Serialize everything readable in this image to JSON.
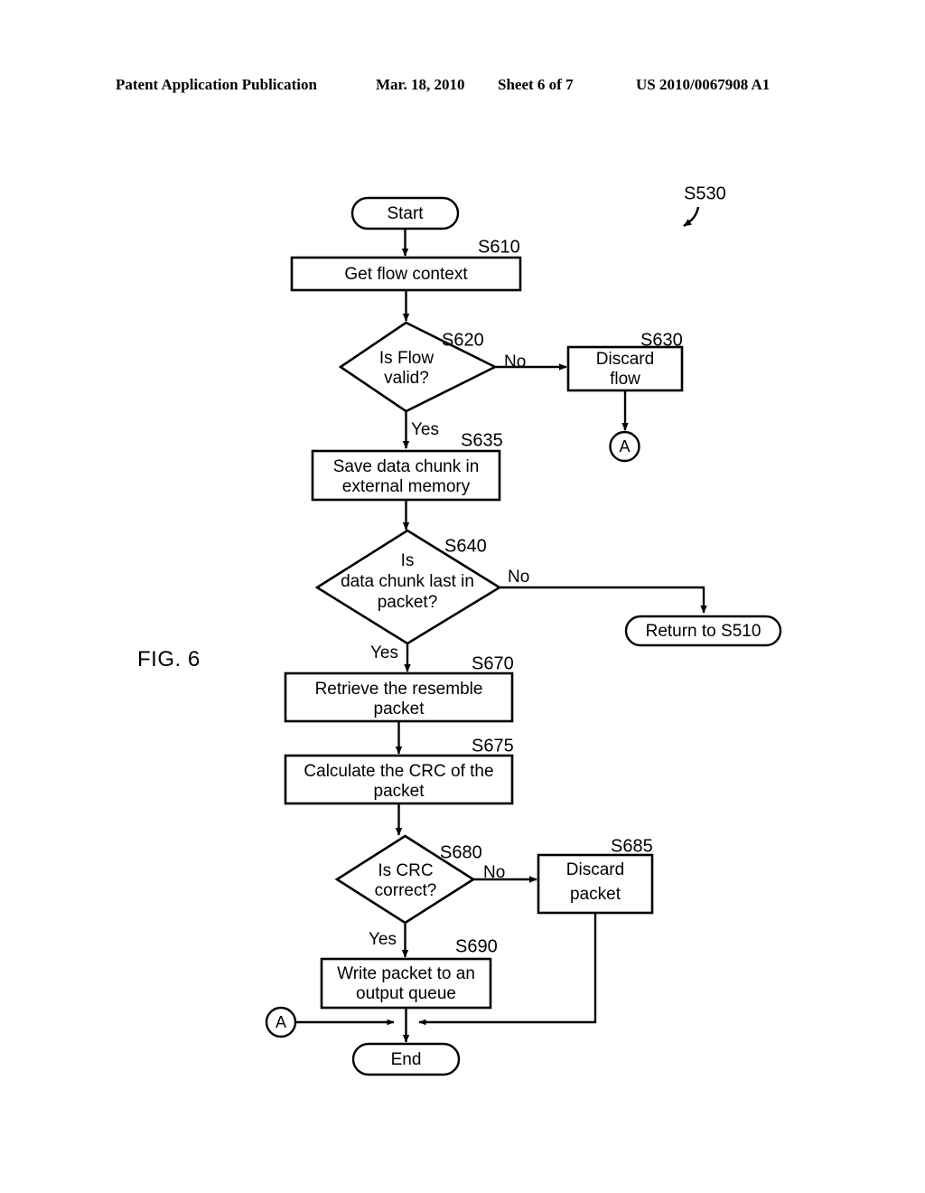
{
  "header": {
    "publication": "Patent Application Publication",
    "date": "Mar. 18, 2010",
    "sheet": "Sheet 6 of 7",
    "patent_number": "US 2010/0067908 A1"
  },
  "figure": {
    "label": "FIG. 6",
    "overall_ref": "S530"
  },
  "flowchart": {
    "type": "flowchart",
    "nodes": [
      {
        "id": "start",
        "shape": "terminator",
        "ref": "",
        "label": "Start"
      },
      {
        "id": "s610",
        "shape": "process",
        "ref": "S610",
        "label": "Get flow context"
      },
      {
        "id": "s620",
        "shape": "decision",
        "ref": "S620",
        "label_line1": "Is Flow",
        "label_line2": "valid?"
      },
      {
        "id": "s630",
        "shape": "process",
        "ref": "S630",
        "label_line1": "Discard",
        "label_line2": "flow"
      },
      {
        "id": "conn_a_top",
        "shape": "connector",
        "ref": "",
        "label": "A"
      },
      {
        "id": "s635",
        "shape": "process",
        "ref": "S635",
        "label_line1": "Save data chunk in",
        "label_line2": "external memory"
      },
      {
        "id": "s640",
        "shape": "decision",
        "ref": "S640",
        "label_line1": "Is",
        "label_line2": "data chunk last in",
        "label_line3": "packet?"
      },
      {
        "id": "return510",
        "shape": "terminator",
        "ref": "",
        "label": "Return to S510"
      },
      {
        "id": "s670",
        "shape": "process",
        "ref": "S670",
        "label_line1": "Retrieve the resemble",
        "label_line2": "packet"
      },
      {
        "id": "s675",
        "shape": "process",
        "ref": "S675",
        "label_line1": "Calculate the CRC of the",
        "label_line2": "packet"
      },
      {
        "id": "s680",
        "shape": "decision",
        "ref": "S680",
        "label_line1": "Is CRC",
        "label_line2": "correct?"
      },
      {
        "id": "s685",
        "shape": "process",
        "ref": "S685",
        "label_line1": "Discard",
        "label_line2": "packet"
      },
      {
        "id": "s690",
        "shape": "process",
        "ref": "S690",
        "label_line1": "Write packet to an",
        "label_line2": "output queue"
      },
      {
        "id": "conn_a_bottom",
        "shape": "connector",
        "ref": "",
        "label": "A"
      },
      {
        "id": "end",
        "shape": "terminator",
        "ref": "",
        "label": "End"
      }
    ],
    "edges": [
      {
        "from": "start",
        "to": "s610",
        "label": ""
      },
      {
        "from": "s610",
        "to": "s620",
        "label": ""
      },
      {
        "from": "s620",
        "to": "s630",
        "label": "No"
      },
      {
        "from": "s620",
        "to": "s635",
        "label": "Yes"
      },
      {
        "from": "s630",
        "to": "conn_a_top",
        "label": ""
      },
      {
        "from": "s635",
        "to": "s640",
        "label": ""
      },
      {
        "from": "s640",
        "to": "return510",
        "label": "No"
      },
      {
        "from": "s640",
        "to": "s670",
        "label": "Yes"
      },
      {
        "from": "s670",
        "to": "s675",
        "label": ""
      },
      {
        "from": "s675",
        "to": "s680",
        "label": ""
      },
      {
        "from": "s680",
        "to": "s685",
        "label": "No"
      },
      {
        "from": "s680",
        "to": "s690",
        "label": "Yes"
      },
      {
        "from": "s690",
        "to": "end",
        "label": ""
      },
      {
        "from": "s685",
        "to": "end",
        "label": ""
      },
      {
        "from": "conn_a_bottom",
        "to": "end",
        "label": ""
      }
    ],
    "labels": {
      "start": "Start",
      "s610": "Get flow context",
      "s620_l1": "Is Flow",
      "s620_l2": "valid?",
      "s630_l1": "Discard",
      "s630_l2": "flow",
      "s635_l1": "Save data chunk in",
      "s635_l2": "external memory",
      "s640_l1": "Is",
      "s640_l2": "data chunk last in",
      "s640_l3": "packet?",
      "return510": "Return to S510",
      "s670_l1": "Retrieve the resemble",
      "s670_l2": "packet",
      "s675_l1": "Calculate the CRC of the",
      "s675_l2": "packet",
      "s680_l1": "Is CRC",
      "s680_l2": "correct?",
      "s685_l1": "Discard",
      "s685_l2": "packet",
      "s690_l1": "Write packet to an",
      "s690_l2": "output queue",
      "end": "End",
      "connector_a_top": "A",
      "connector_a_bottom": "A"
    },
    "refs": {
      "s530": "S530",
      "s610": "S610",
      "s620": "S620",
      "s630": "S630",
      "s635": "S635",
      "s640": "S640",
      "s670": "S670",
      "s675": "S675",
      "s680": "S680",
      "s685": "S685",
      "s690": "S690"
    },
    "branch_labels": {
      "s620_no": "No",
      "s620_yes": "Yes",
      "s640_no": "No",
      "s640_yes": "Yes",
      "s680_no": "No",
      "s680_yes": "Yes"
    }
  },
  "colors": {
    "ink": "#000000",
    "paper": "#ffffff"
  }
}
